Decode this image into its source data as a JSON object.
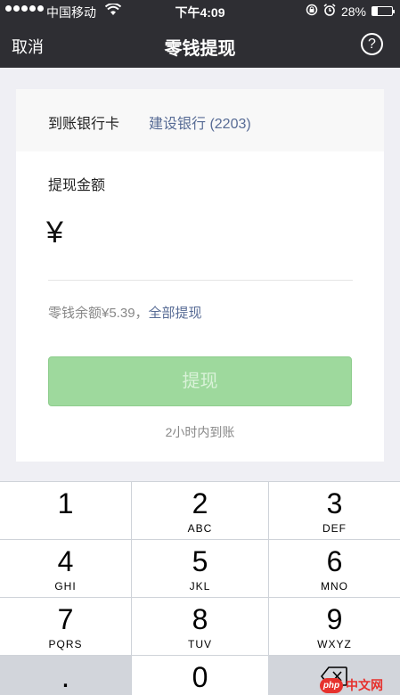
{
  "status": {
    "carrier": "中国移动",
    "time": "下午4:09",
    "battery": "28%",
    "battery_level": 0.28
  },
  "nav": {
    "cancel": "取消",
    "title": "零钱提现",
    "help": "?"
  },
  "form": {
    "bank_label": "到账银行卡",
    "bank_value": "建设银行 (2203)",
    "amount_label": "提现金额",
    "currency": "¥",
    "amount_value": "",
    "balance_text": "零钱余额¥5.39，",
    "withdraw_all": "全部提现",
    "submit": "提现",
    "arrival": "2小时内到账"
  },
  "keypad": {
    "keys": [
      {
        "digit": "1",
        "letters": ""
      },
      {
        "digit": "2",
        "letters": "ABC"
      },
      {
        "digit": "3",
        "letters": "DEF"
      },
      {
        "digit": "4",
        "letters": "GHI"
      },
      {
        "digit": "5",
        "letters": "JKL"
      },
      {
        "digit": "6",
        "letters": "MNO"
      },
      {
        "digit": "7",
        "letters": "PQRS"
      },
      {
        "digit": "8",
        "letters": "TUV"
      },
      {
        "digit": "9",
        "letters": "WXYZ"
      },
      {
        "digit": ".",
        "letters": ""
      },
      {
        "digit": "0",
        "letters": ""
      }
    ],
    "delete_icon": "backspace-icon"
  },
  "watermark": {
    "badge": "php",
    "text": "中文网"
  }
}
